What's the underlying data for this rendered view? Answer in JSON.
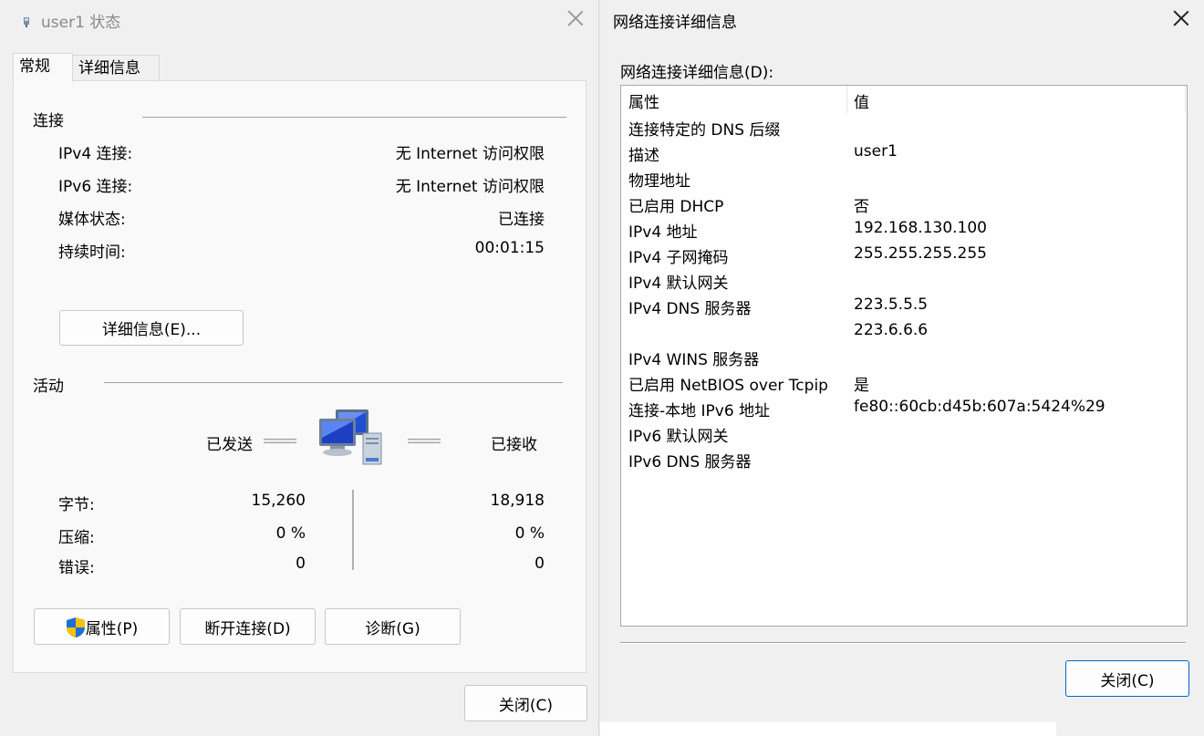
{
  "status_window": {
    "title": "user1 状态",
    "tabs": [
      "常规",
      "详细信息"
    ],
    "connection": {
      "group_label": "连接",
      "rows": [
        {
          "label": "IPv4 连接:",
          "value": "无 Internet 访问权限"
        },
        {
          "label": "IPv6 连接:",
          "value": "无 Internet 访问权限"
        },
        {
          "label": "媒体状态:",
          "value": "已连接"
        },
        {
          "label": "持续时间:",
          "value": "00:01:15"
        }
      ],
      "details_button": "详细信息(E)..."
    },
    "activity": {
      "group_label": "活动",
      "sent_label": "已发送",
      "received_label": "已接收",
      "rows": [
        {
          "label": "字节:",
          "sent": "15,260",
          "received": "18,918"
        },
        {
          "label": "压缩:",
          "sent": "0 %",
          "received": "0 %"
        },
        {
          "label": "错误:",
          "sent": "0",
          "received": "0"
        }
      ]
    },
    "buttons": {
      "properties": "属性(P)",
      "disconnect": "断开连接(D)",
      "diagnose": "诊断(G)",
      "close": "关闭(C)"
    }
  },
  "details_window": {
    "title": "网络连接详细信息",
    "list_label": "网络连接详细信息(D):",
    "columns": [
      "属性",
      "值"
    ],
    "rows": [
      {
        "property": "连接特定的 DNS 后缀",
        "value": ""
      },
      {
        "property": "描述",
        "value": "user1"
      },
      {
        "property": "物理地址",
        "value": ""
      },
      {
        "property": "已启用 DHCP",
        "value": "否"
      },
      {
        "property": "IPv4 地址",
        "value": "192.168.130.100"
      },
      {
        "property": "IPv4 子网掩码",
        "value": "255.255.255.255"
      },
      {
        "property": "IPv4 默认网关",
        "value": ""
      },
      {
        "property": "IPv4 DNS 服务器",
        "value": "223.5.5.5"
      },
      {
        "property": "",
        "value": "223.6.6.6"
      },
      {
        "property": "IPv4 WINS 服务器",
        "value": ""
      },
      {
        "property": "已启用 NetBIOS over Tcpip",
        "value": "是"
      },
      {
        "property": "连接-本地 IPv6 地址",
        "value": "fe80::60cb:d45b:607a:5424%29"
      },
      {
        "property": "IPv6 默认网关",
        "value": ""
      },
      {
        "property": "IPv6 DNS 服务器",
        "value": ""
      }
    ],
    "close_button": "关闭(C)"
  },
  "icons": {
    "title_icon": "network-adapter-icon",
    "activity_icon": "network-computers-icon",
    "shield_icon": "uac-shield-icon",
    "close_icon": "close-icon"
  },
  "colors": {
    "background": "#f0f0f0",
    "panel": "#f9f9f9",
    "primary_border": "#0a64c8"
  }
}
